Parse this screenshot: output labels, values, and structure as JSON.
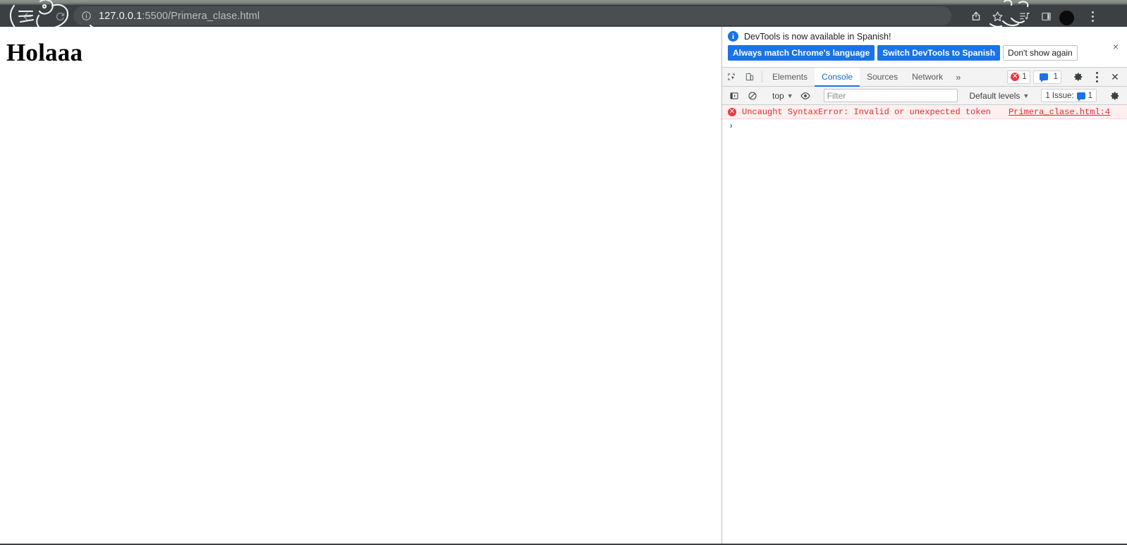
{
  "browser": {
    "back_icon": "back-arrow-icon",
    "reload_icon": "reload-icon",
    "site_info_icon": "info-circle-icon",
    "url_host": "127.0.0.1",
    "url_rest": ":5500/Primera_clase.html",
    "url_full": "127.0.0.1:5500/Primera_clase.html",
    "share_icon": "share-icon",
    "bookmark_icon": "star-icon",
    "media_icon": "media-list-icon",
    "side_panel_icon": "side-panel-icon",
    "avatar": "profile-avatar",
    "menu_icon": "kebab-menu-icon"
  },
  "page": {
    "heading": "Holaaa"
  },
  "devtools": {
    "infobar": {
      "info_icon": "i",
      "message": "DevTools is now available in Spanish!",
      "buttons": [
        {
          "label": "Always match Chrome's language",
          "style": "primary"
        },
        {
          "label": "Switch DevTools to Spanish",
          "style": "primary"
        },
        {
          "label": "Don't show again",
          "style": "secondary"
        }
      ],
      "close_label": "×"
    },
    "tabbar": {
      "inspect_icon": "inspect-element-icon",
      "device_icon": "device-toolbar-icon",
      "tabs": [
        {
          "label": "Elements",
          "active": false
        },
        {
          "label": "Console",
          "active": true
        },
        {
          "label": "Sources",
          "active": false
        },
        {
          "label": "Network",
          "active": false
        }
      ],
      "overflow_label": "»",
      "error_count": "1",
      "message_count": "1",
      "settings_icon": "gear-icon",
      "more_icon": "kebab-menu-icon",
      "close_label": "✕"
    },
    "console_toolbar": {
      "sidebar_icon": "console-sidebar-icon",
      "clear_icon": "clear-console-icon",
      "context": "top",
      "eye_icon": "live-expression-eye-icon",
      "filter_placeholder": "Filter",
      "filter_value": "",
      "levels": "Default levels",
      "issues_label": "1 Issue:",
      "issues_count": "1",
      "settings_icon": "gear-icon"
    },
    "console": {
      "error_icon": "✕",
      "error_text": "Uncaught SyntaxError: Invalid or unexpected token",
      "error_source": "Primera_clase.html:4",
      "prompt": "›"
    }
  },
  "colors": {
    "chrome_bg": "#3c4043",
    "accent_blue": "#1a73e8",
    "error_red": "#eb3941",
    "error_bg": "#fff0f0"
  }
}
